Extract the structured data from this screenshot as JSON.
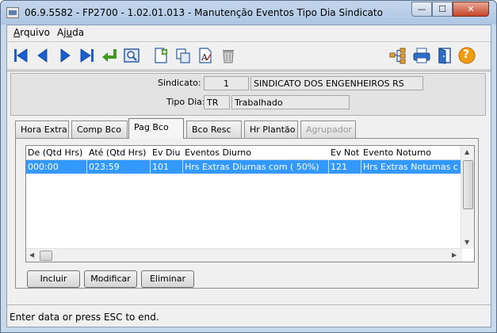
{
  "window": {
    "title": "06.9.5582 - FP2700 - 1.02.01.013 - Manutenção Eventos Tipo Dia Sindicato",
    "min_label": "—",
    "max_label": "☐",
    "close_label": "✕"
  },
  "menu": {
    "arquivo_first": "A",
    "arquivo_rest": "rquivo",
    "ajuda_first": "Aj",
    "ajuda_u": "u",
    "ajuda_rest": "da"
  },
  "toolbar": {
    "icons": [
      "first-record-icon",
      "previous-record-icon",
      "next-record-icon",
      "last-record-icon",
      "return-icon",
      "preview-icon",
      "new-document-icon",
      "copy-icon",
      "edit-text-icon",
      "trash-icon",
      "tree-icon",
      "printer-icon",
      "exit-door-icon",
      "help-icon"
    ],
    "help_glyph": "?"
  },
  "header": {
    "sindicato_label": "Sindicato:",
    "sindicato_code": "1",
    "sindicato_name": "SINDICATO DOS ENGENHEIROS RS",
    "tipo_dia_label": "Tipo Dia:",
    "tipo_dia_code": "TR",
    "tipo_dia_name": "Trabalhado"
  },
  "tabs": [
    {
      "label": "Hora Extra"
    },
    {
      "label": "Comp Bco"
    },
    {
      "label": "Pag Bco"
    },
    {
      "label": "Bco Resc"
    },
    {
      "label": "Hr Plantão"
    },
    {
      "label": "Agrupador"
    }
  ],
  "grid": {
    "columns": [
      "De (Qtd Hrs)",
      "Até (Qtd Hrs)",
      "Ev Diu",
      "Eventos Diurno",
      "Ev Not",
      "Evento Noturno"
    ],
    "rows": [
      [
        "000:00",
        "023:59",
        "101",
        "Hrs Extras Diurnas  com ( 50%)",
        "121",
        "Hrs Extras Noturnas c"
      ]
    ]
  },
  "buttons": {
    "incluir": "Incluir",
    "modificar": "Modificar",
    "eliminar": "Eliminar"
  },
  "status": {
    "text": "Enter data or press ESC to end."
  },
  "colors": {
    "selection": "#3399ff",
    "nav_blue": "#1a5fd0",
    "return_green": "#3f9a1e",
    "help_orange": "#f39c12"
  }
}
